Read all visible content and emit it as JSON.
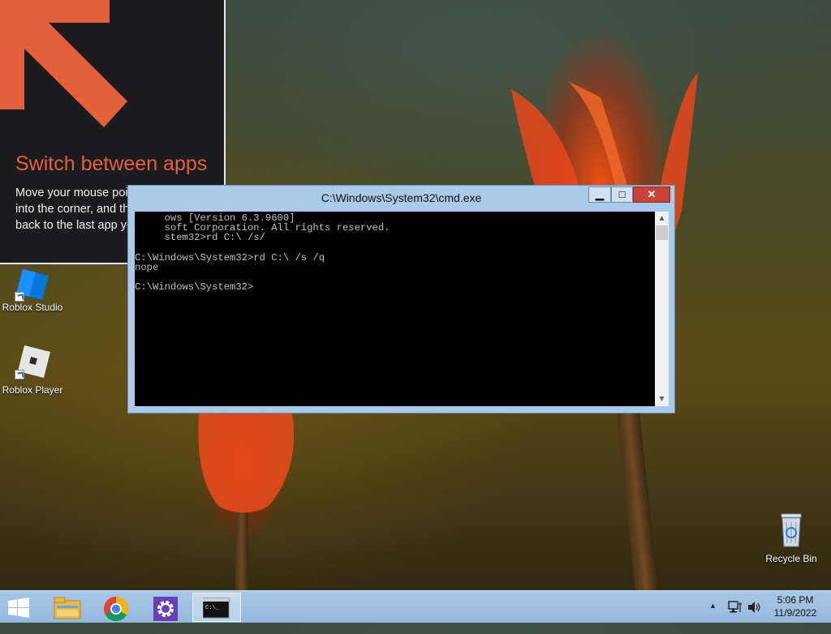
{
  "tip": {
    "title": "Switch between apps",
    "text": "Move your mouse pointer all the way into the corner, and then click to go back to the last app you were using."
  },
  "desktop": {
    "icons": [
      {
        "label": "Roblox Studio",
        "icon": "roblox-studio-icon"
      },
      {
        "label": "Roblox Player",
        "icon": "roblox-player-icon"
      },
      {
        "label": "Recycle Bin",
        "icon": "recycle-bin-icon"
      }
    ]
  },
  "cmd": {
    "title": "C:\\Windows\\System32\\cmd.exe",
    "lines": [
      "     ows [Version 6.3.9600]",
      "     soft Corporation. All rights reserved.",
      "     stem32>rd C:\\ /s/",
      "",
      "C:\\Windows\\System32>rd C:\\ /s /q",
      "nope",
      "",
      "C:\\Windows\\System32>"
    ]
  },
  "taskbar": {
    "items": [
      "start-icon",
      "file-explorer-icon",
      "chrome-icon",
      "settings-icon",
      "cmd-icon"
    ]
  },
  "tray": {
    "time": "5:06 PM",
    "date": "11/9/2022"
  },
  "colors": {
    "tip_accent": "#e3603a",
    "close_button": "#c7433a",
    "taskbar": "#a9c8e6"
  }
}
